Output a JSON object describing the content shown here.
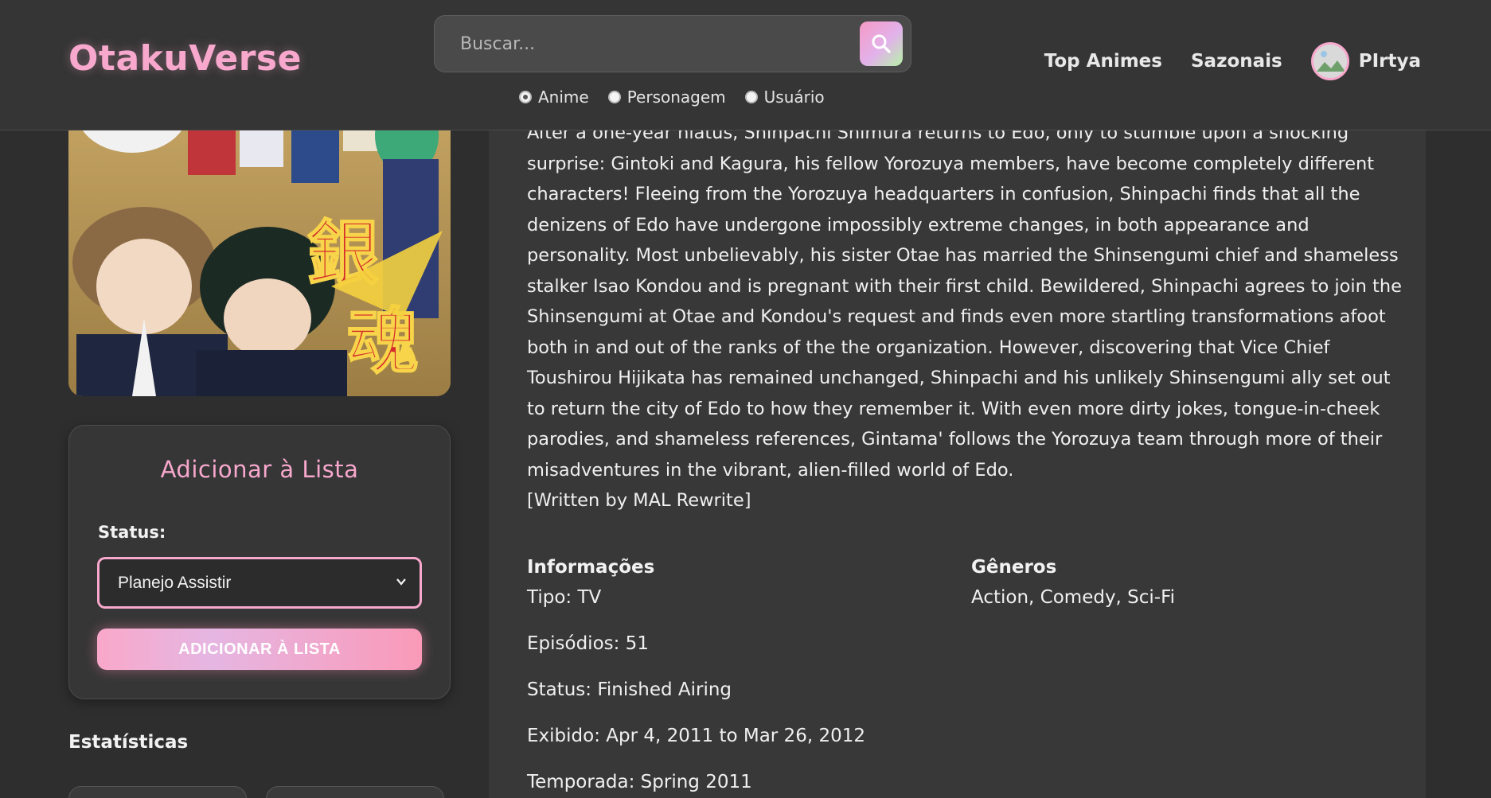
{
  "header": {
    "logo": "OtakuVerse",
    "search": {
      "placeholder": "Buscar...",
      "icon": "search-icon",
      "types": [
        {
          "label": "Anime",
          "checked": true
        },
        {
          "label": "Personagem",
          "checked": false
        },
        {
          "label": "Usuário",
          "checked": false
        }
      ]
    },
    "nav": {
      "top_animes": "Top Animes",
      "sazonais": "Sazonais",
      "username": "PIrtya"
    }
  },
  "sidebar": {
    "add_title": "Adicionar à Lista",
    "status_label": "Status:",
    "status_selected": "Planejo Assistir",
    "add_button": "ADICIONAR À LISTA",
    "stats_title": "Estatísticas"
  },
  "main": {
    "synopsis": "After a one-year hiatus, Shinpachi Shimura returns to Edo, only to stumble upon a shocking surprise: Gintoki and Kagura, his fellow Yorozuya members, have become completely different characters! Fleeing from the Yorozuya headquarters in confusion, Shinpachi finds that all the denizens of Edo have undergone impossibly extreme changes, in both appearance and personality. Most unbelievably, his sister Otae has married the Shinsengumi chief and shameless stalker Isao Kondou and is pregnant with their first child. Bewildered, Shinpachi agrees to join the Shinsengumi at Otae and Kondou's request and finds even more startling transformations afoot both in and out of the ranks of the the organization. However, discovering that Vice Chief Toushirou Hijikata has remained unchanged, Shinpachi and his unlikely Shinsengumi ally set out to return the city of Edo to how they remember it. With even more dirty jokes, tongue-in-cheek parodies, and shameless references, Gintama' follows the Yorozuya team through more of their misadventures in the vibrant, alien-filled world of Edo.",
    "synopsis_credit": "[Written by MAL Rewrite]",
    "info_title": "Informações",
    "info": {
      "tipo": "Tipo: TV",
      "episodios": "Episódios: 51",
      "status": "Status: Finished Airing",
      "exibido": "Exibido: Apr 4, 2011 to Mar 26, 2012",
      "temporada": "Temporada: Spring 2011"
    },
    "genres_title": "Gêneros",
    "genres": "Action, Comedy, Sci-Fi"
  },
  "colors": {
    "accent_pink": "#f7a8cc",
    "background": "#2e2e2e",
    "panel": "#383838"
  }
}
